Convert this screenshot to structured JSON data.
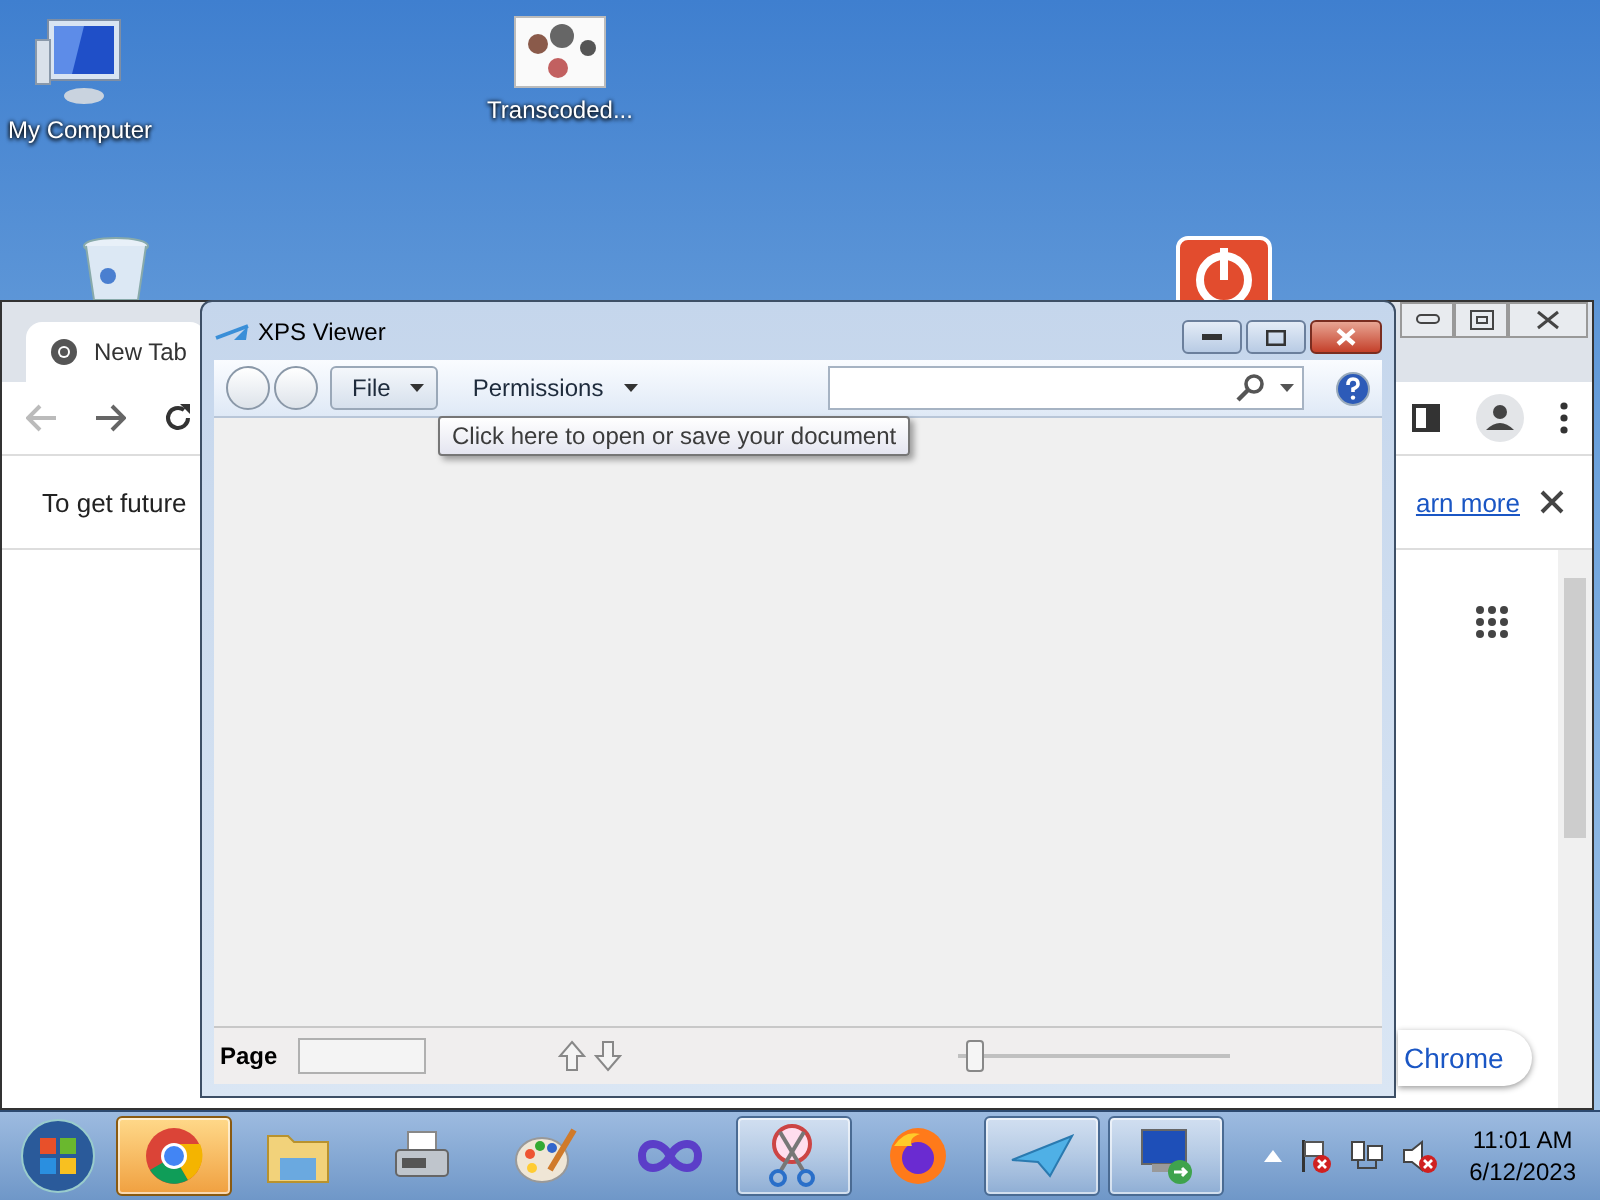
{
  "desktop_icons": [
    {
      "kind": "computer",
      "label": "My Computer"
    },
    {
      "kind": "picture",
      "label": "Transcoded..."
    },
    {
      "kind": "recycle"
    },
    {
      "kind": "power"
    }
  ],
  "browser_window": {
    "tabs": [
      {
        "label": "New Tab",
        "selected": true
      }
    ],
    "infobar": {
      "text": "To get future",
      "link": "arn more"
    },
    "content_button": "Chrome"
  },
  "xps_viewer": {
    "title": "XPS Viewer",
    "menus": [
      {
        "label": "File",
        "kind": "button"
      },
      {
        "label": "Permissions",
        "kind": "menu"
      }
    ],
    "tooltip": "Click here to open or save your document",
    "status_bar": {
      "page_label": "Page",
      "zoom": {
        "level": 0.03
      }
    }
  },
  "taskbar": {
    "items": [
      {
        "kind": "chrome",
        "selected": true,
        "running": true
      },
      {
        "kind": "explorer",
        "selected": false,
        "running": false
      },
      {
        "kind": "fax",
        "selected": false,
        "running": false
      },
      {
        "kind": "paint",
        "selected": false,
        "running": false
      },
      {
        "kind": "infinity",
        "selected": false,
        "running": false
      },
      {
        "kind": "snipping",
        "selected": false,
        "running": true
      },
      {
        "kind": "firefox",
        "selected": false,
        "running": false
      },
      {
        "kind": "plane",
        "selected": false,
        "running": true
      },
      {
        "kind": "remote",
        "selected": false,
        "running": true
      }
    ],
    "clock": {
      "time": "11:01 AM",
      "date": "6/12/2023"
    }
  }
}
